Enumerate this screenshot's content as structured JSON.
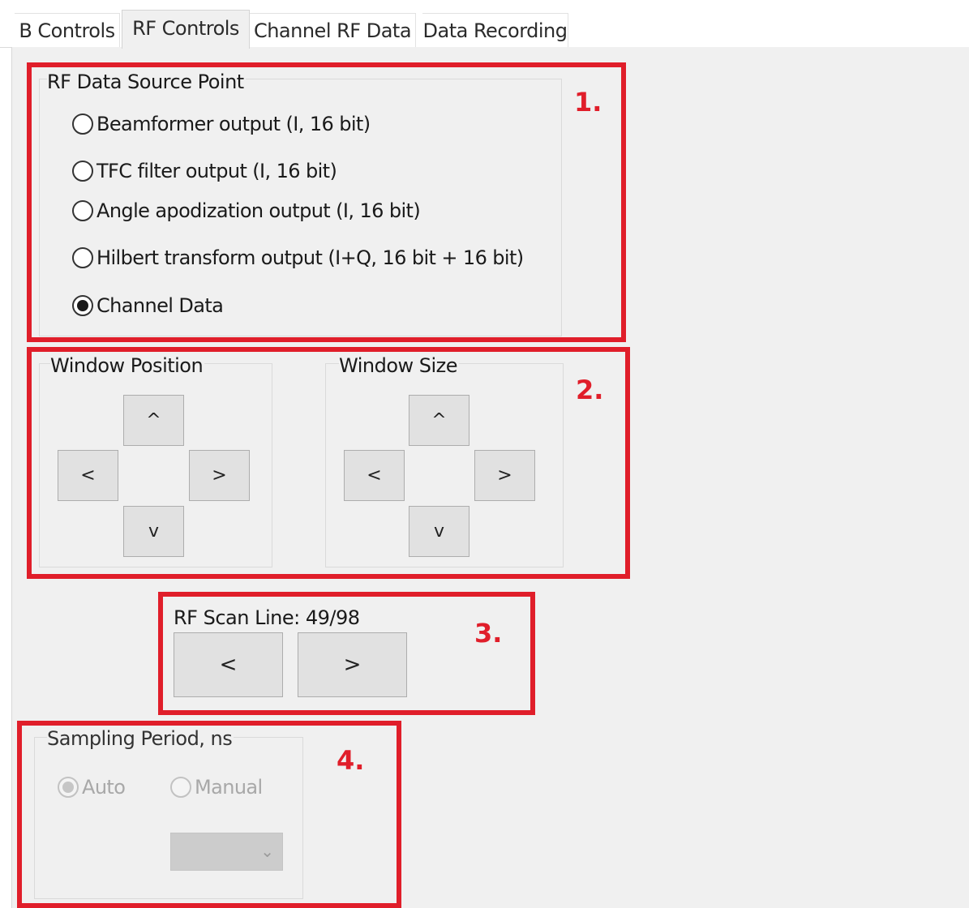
{
  "tabs": [
    "B Controls",
    "RF Controls",
    "Channel RF Data",
    "Data Recording"
  ],
  "rf_source": {
    "title": "RF Data Source Point",
    "options": [
      {
        "label": "Beamformer output (I, 16 bit)",
        "checked": false
      },
      {
        "label": "TFC filter output (I, 16 bit)",
        "checked": false
      },
      {
        "label": "Angle apodization output (I, 16 bit)",
        "checked": false
      },
      {
        "label": "Hilbert transform output (I+Q, 16 bit + 16 bit)",
        "checked": false
      },
      {
        "label": "Channel Data",
        "checked": true
      }
    ]
  },
  "window_position": {
    "title": "Window Position",
    "up": "^",
    "left": "<",
    "right": ">",
    "down": "v"
  },
  "window_size": {
    "title": "Window Size",
    "up": "^",
    "left": "<",
    "right": ">",
    "down": "v"
  },
  "scan_line": {
    "label": "RF Scan Line: 49/98",
    "prev": "<",
    "next": ">"
  },
  "sampling": {
    "title": "Sampling Period, ns",
    "auto_label": "Auto",
    "auto_checked": true,
    "manual_label": "Manual",
    "manual_checked": false,
    "enabled": false
  },
  "annotations": {
    "m1": "1.",
    "m2": "2.",
    "m3": "3.",
    "m4": "4.",
    "color": "#e01e2a"
  }
}
